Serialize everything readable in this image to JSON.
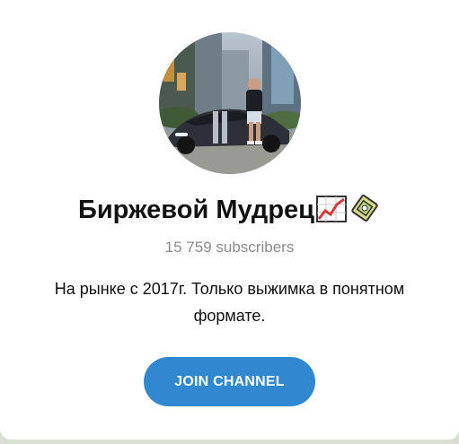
{
  "channel": {
    "name": "Биржевой Мудрец",
    "title_emojis": [
      "chart-increasing-emoji",
      "gem-ring-emoji"
    ],
    "subscribers": "15 759 subscribers",
    "description": "На рынке с 2017г. Только выжимка в понятном формате."
  },
  "actions": {
    "join_label": "JOIN CHANNEL"
  },
  "colors": {
    "accent": "#2f88d0",
    "subtitle": "#8a8a8a",
    "text": "#111111"
  }
}
